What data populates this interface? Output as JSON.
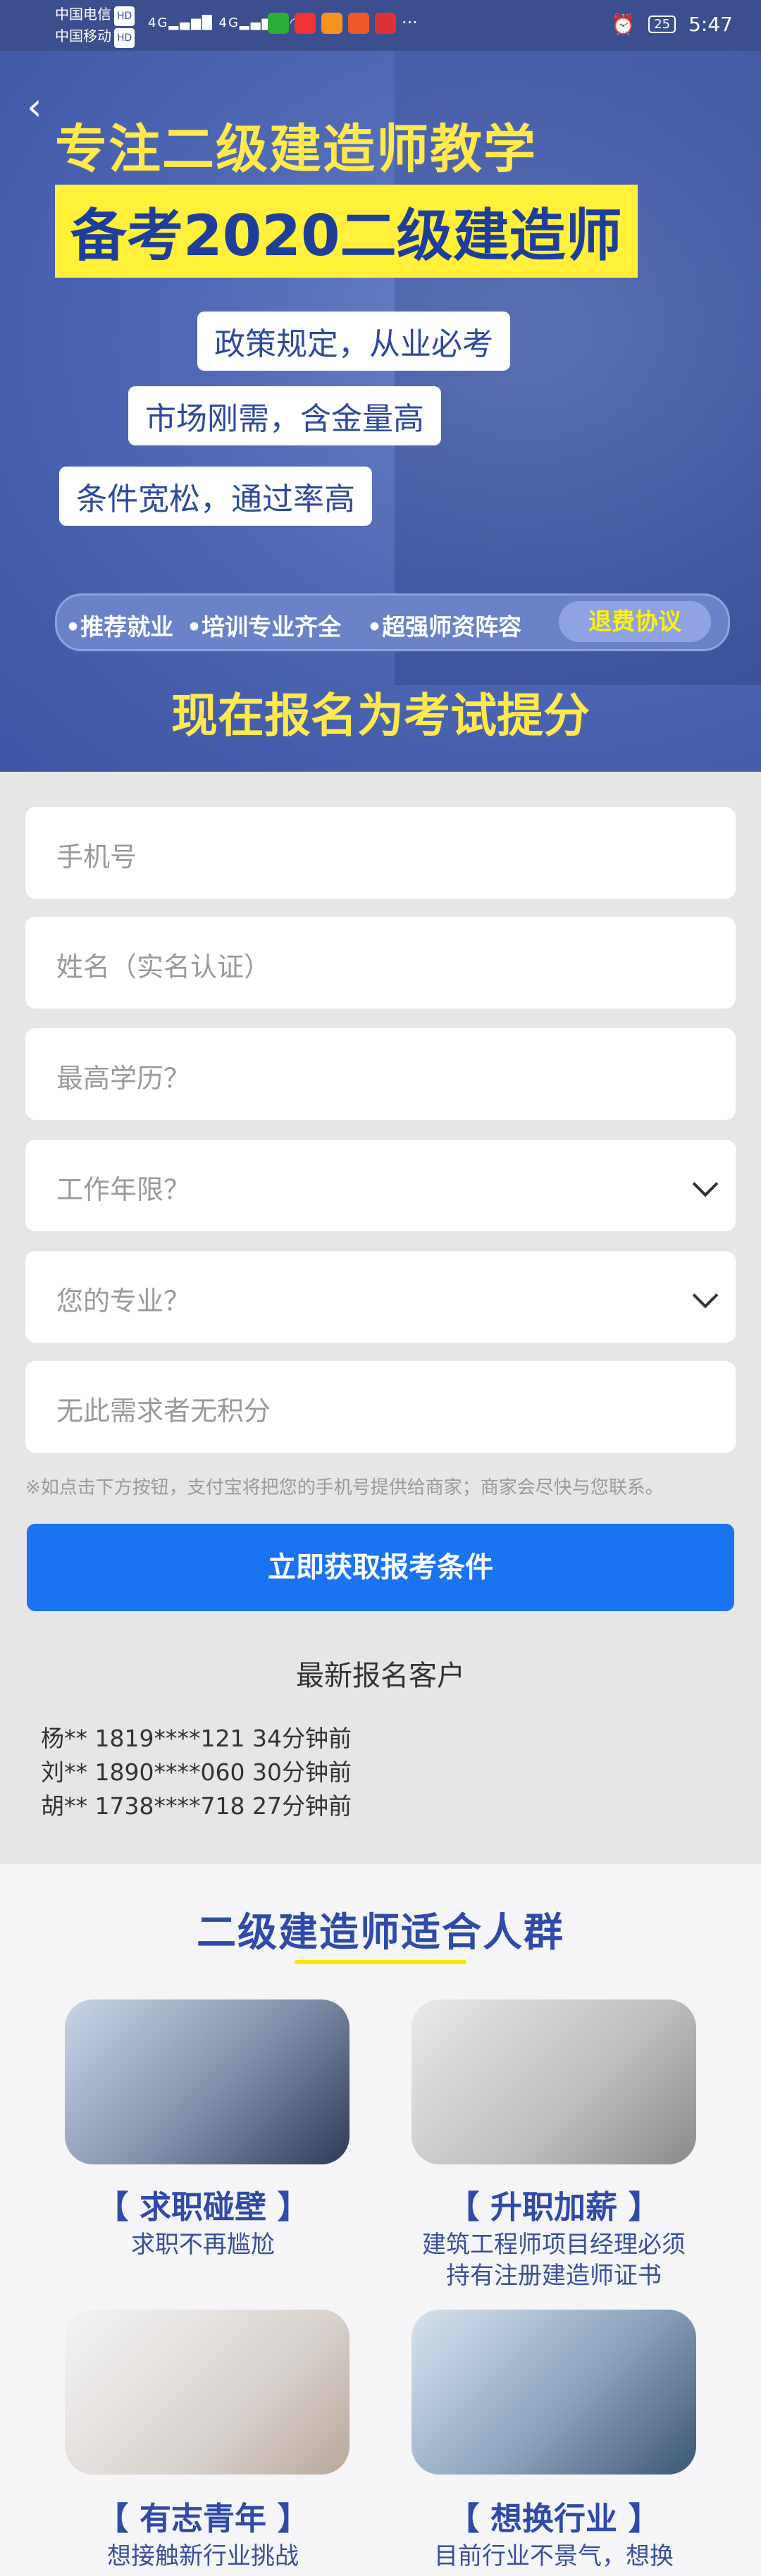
{
  "status_bar": {
    "carrier1": "中国电信",
    "carrier2": "中国移动",
    "hd": "HD",
    "network": "4G",
    "battery": "25",
    "time": "5:47"
  },
  "banner": {
    "title1": "专注二级建造师教学",
    "title2": "备考2020二级建造师",
    "tags": [
      "政策规定，从业必考",
      "市场刚需，含金量高",
      "条件宽松，通过率高"
    ],
    "features": [
      "•推荐就业",
      "•培训专业齐全",
      "•超强师资阵容"
    ],
    "refund": "退费协议",
    "cta": "现在报名为考试提分"
  },
  "form": {
    "fields": [
      "手机号",
      "姓名（实名认证）",
      "最高学历？",
      "工作年限？",
      "您的专业？",
      "无此需求者无积分"
    ],
    "notice": "※如点击下方按钮，支付宝将把您的手机号提供给商家；商家会尽快与您联系。",
    "submit": "立即获取报考条件",
    "latest_title": "最新报名客户",
    "recent": [
      "杨** 1819****121 34分钟前",
      "刘** 1890****060 30分钟前",
      "胡** 1738****718 27分钟前"
    ]
  },
  "audience": {
    "title": "二级建造师适合人群",
    "cards": [
      {
        "head": "【 求职碰壁 】",
        "desc": "求职不再尴尬"
      },
      {
        "head": "【 升职加薪 】",
        "desc": "建筑工程师项目经理必须\n持有注册建造师证书"
      },
      {
        "head": "【 有志青年 】",
        "desc": "想接触新行业挑战"
      },
      {
        "head": "【 想换行业 】",
        "desc": "目前行业不景气，想换"
      }
    ]
  }
}
